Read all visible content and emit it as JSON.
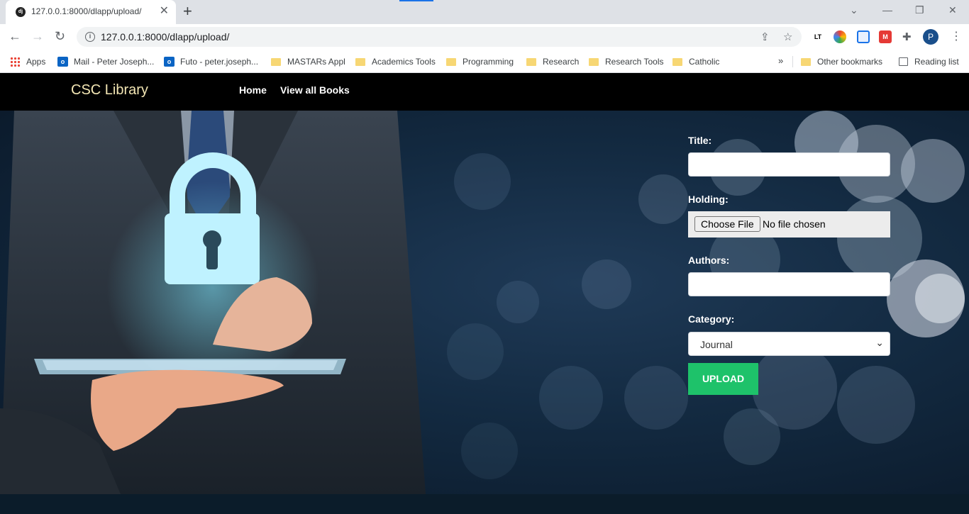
{
  "browser": {
    "tab_title": "127.0.0.1:8000/dlapp/upload/",
    "tab_favicon": "django-icon",
    "url": "127.0.0.1:8000/dlapp/upload/",
    "profile_initial": "P",
    "bookmarks": [
      {
        "label": "Apps",
        "icon": "apps-grid-icon"
      },
      {
        "label": "Mail - Peter Joseph...",
        "icon": "outlook-icon"
      },
      {
        "label": "Futo - peter.joseph...",
        "icon": "outlook-icon"
      },
      {
        "label": "MASTARs Appl",
        "icon": "folder-icon"
      },
      {
        "label": "Academics Tools",
        "icon": "folder-icon"
      },
      {
        "label": "Programming",
        "icon": "folder-icon"
      },
      {
        "label": "Research",
        "icon": "folder-icon"
      },
      {
        "label": "Research Tools",
        "icon": "folder-icon"
      },
      {
        "label": "Catholic",
        "icon": "folder-icon"
      }
    ],
    "more_bookmarks": "»",
    "other_bookmarks": "Other bookmarks",
    "reading_list": "Reading list"
  },
  "navbar": {
    "brand": "CSC Library",
    "links": [
      "Home",
      "View all Books"
    ]
  },
  "form": {
    "title_label": "Title:",
    "title_value": "",
    "holding_label": "Holding:",
    "file_button": "Choose File",
    "file_status": "No file chosen",
    "authors_label": "Authors:",
    "authors_value": "",
    "category_label": "Category:",
    "category_selected": "Journal",
    "upload_button": "UPLOAD"
  },
  "colors": {
    "navbar_bg": "#000000",
    "brand": "#f3e6b4",
    "upload_button": "#1ec26a",
    "hero_bg": "#132a41"
  }
}
